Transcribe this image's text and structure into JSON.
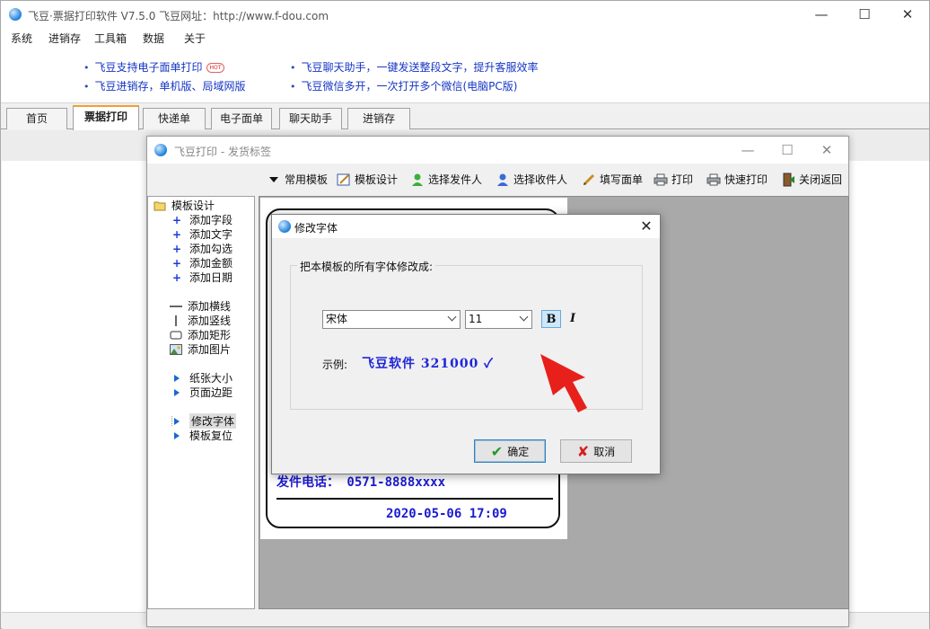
{
  "app": {
    "title": "飞豆·票据打印软件 V7.5.0   飞豆网址：http://www.f-dou.com",
    "menu": [
      "系统",
      "进销存",
      "工具箱",
      "数据",
      "关于"
    ],
    "banner_links": [
      {
        "text": "飞豆支持电子面单打印",
        "badge": "HOT"
      },
      {
        "text": "飞豆聊天助手，一键发送整段文字，提升客服效率"
      },
      {
        "text": "飞豆进销存，单机版、局域网版"
      },
      {
        "text": "飞豆微信多开，一次打开多个微信(电脑PC版)"
      }
    ],
    "tabs": [
      {
        "label": "首页",
        "active": false
      },
      {
        "label": "票据打印",
        "active": true
      },
      {
        "label": "快递单",
        "active": false
      },
      {
        "label": "电子面单",
        "active": false
      },
      {
        "label": "聊天助手",
        "active": false
      },
      {
        "label": "进销存",
        "active": false
      }
    ]
  },
  "child": {
    "title": "飞豆打印 - 发货标签",
    "toolbar": {
      "common_templates": "常用模板",
      "template_design": "模板设计",
      "select_sender": "选择发件人",
      "select_receiver": "选择收件人",
      "fill_form": "填写面单",
      "print": "打印",
      "quick_print": "快速打印",
      "close_return": "关闭返回"
    },
    "tree": {
      "root": "模板设计",
      "add_items": [
        "添加字段",
        "添加文字",
        "添加勾选",
        "添加金额",
        "添加日期"
      ],
      "shape_items": [
        "添加横线",
        "添加竖线",
        "添加矩形",
        "添加图片"
      ],
      "page_items": [
        "纸张大小",
        "页面边距"
      ],
      "font_items": [
        "修改字体",
        "模板复位"
      ]
    },
    "label": {
      "phone": "发件电话： 0571-8888xxxx",
      "datetime": "2020-05-06 17:09"
    }
  },
  "dialog": {
    "title": "修改字体",
    "prompt": "把本模板的所有字体修改成:",
    "font_name": "宋体",
    "font_size": "11",
    "bold_label": "B",
    "italic_label": "I",
    "bold_on": true,
    "sample_label": "示例:",
    "sample_text": "飞豆软件  321000  ✓",
    "ok_label": "确定",
    "cancel_label": "取消"
  },
  "colors": {
    "link": "#1636c4",
    "sample": "#1f26d8",
    "arrow": "#e8201c",
    "tab_accent": "#f0a030"
  }
}
